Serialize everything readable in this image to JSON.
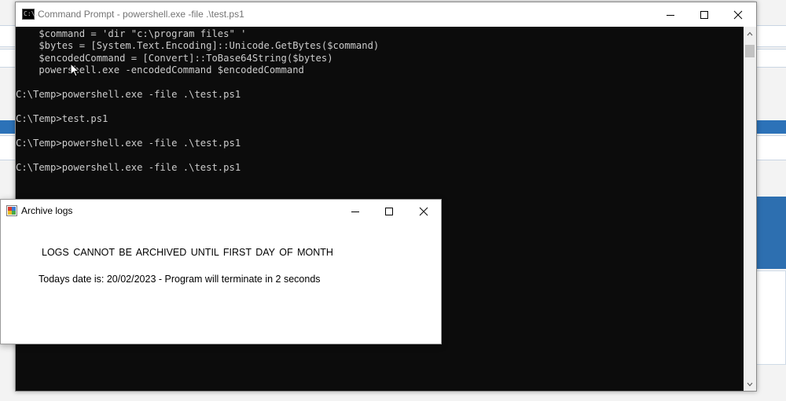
{
  "cmd_window": {
    "title": "Command Prompt - powershell.exe  -file .\\test.ps1",
    "icon_label": "C:\\."
  },
  "console": {
    "lines": [
      "    $command = 'dir \"c:\\program files\" '",
      "    $bytes = [System.Text.Encoding]::Unicode.GetBytes($command)",
      "    $encodedCommand = [Convert]::ToBase64String($bytes)",
      "    powershell.exe -encodedCommand $encodedCommand",
      "",
      "C:\\Temp>powershell.exe -file .\\test.ps1",
      "",
      "C:\\Temp>test.ps1",
      "",
      "C:\\Temp>powershell.exe -file .\\test.ps1",
      "",
      "C:\\Temp>powershell.exe -file .\\test.ps1"
    ]
  },
  "dialog": {
    "title": "Archive logs",
    "message": "LOGS CANNOT BE ARCHIVED UNTIL FIRST DAY OF MONTH",
    "status": "Todays date is: 20/02/2023 - Program will terminate in 2 seconds"
  }
}
